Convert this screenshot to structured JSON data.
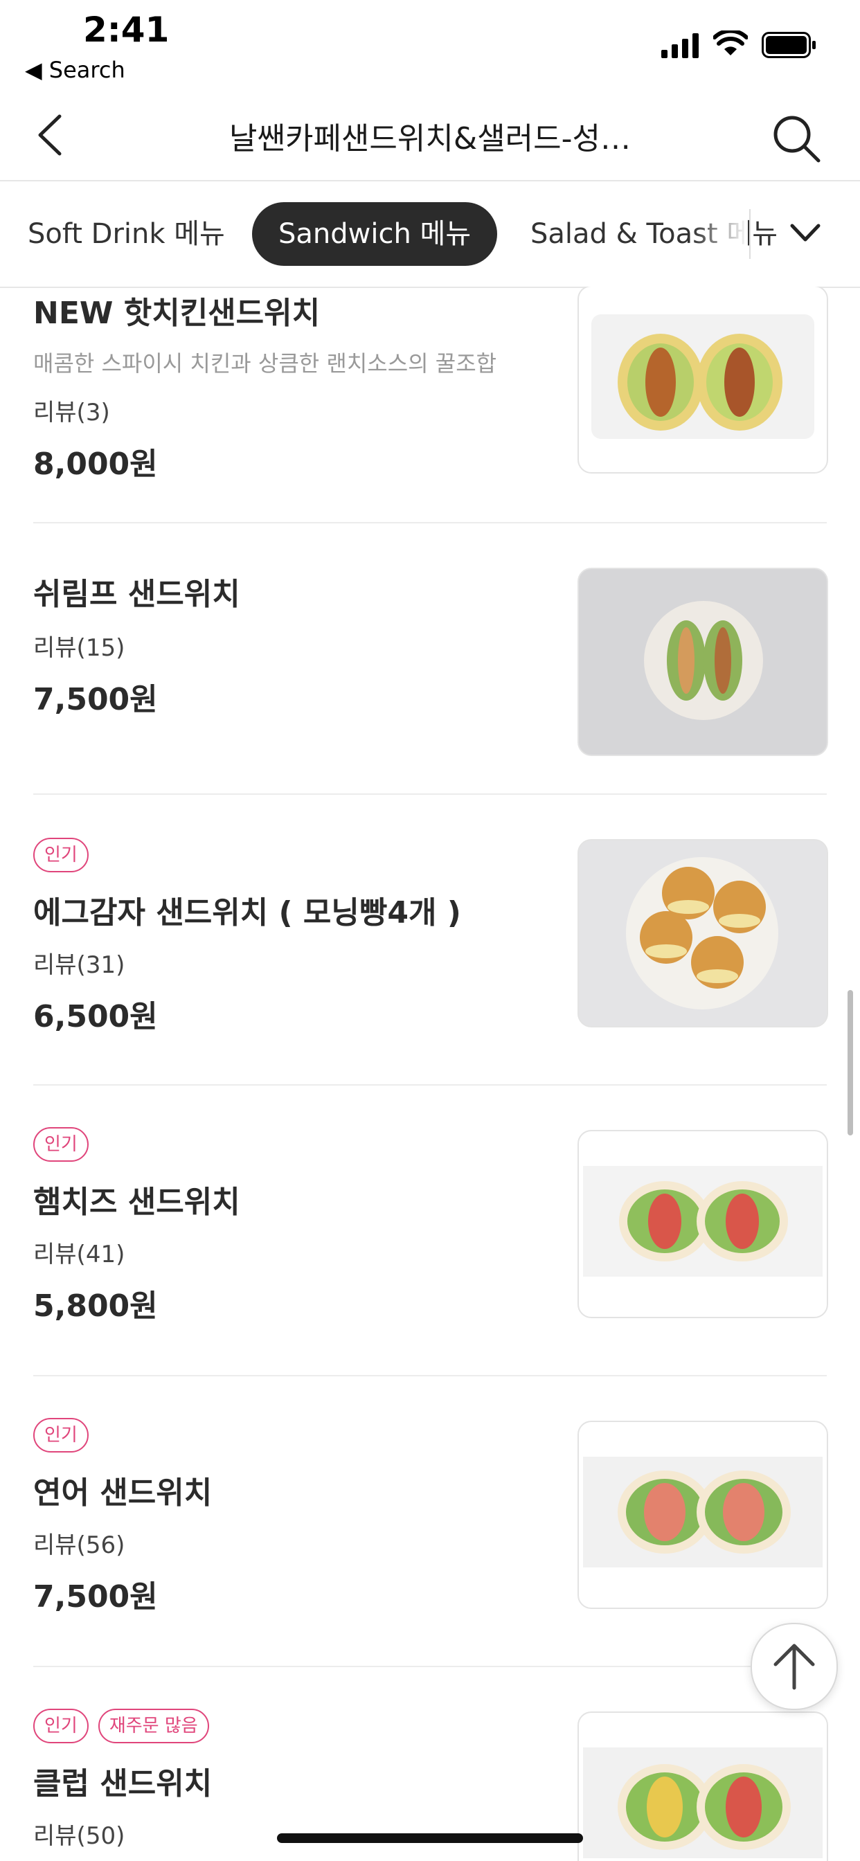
{
  "status_bar": {
    "time": "2:41",
    "back_app": "◀ Search"
  },
  "nav": {
    "title": "날쌘카페샌드위치&샐러드-성…"
  },
  "tabs": [
    {
      "label": "Soft Drink 메뉴",
      "active": false
    },
    {
      "label": "Sandwich 메뉴",
      "active": true
    },
    {
      "label": "Salad & Toast 메뉴",
      "active": false
    }
  ],
  "items": [
    {
      "name": "NEW 핫치킨샌드위치",
      "desc": "매콤한 스파이시 치킨과 상큼한 랜치소스의 꿀조합",
      "review": "리뷰(3)",
      "price": "8,000원",
      "badges": []
    },
    {
      "name": "쉬림프 샌드위치",
      "desc": "",
      "review": "리뷰(15)",
      "price": "7,500원",
      "badges": []
    },
    {
      "name": "에그감자 샌드위치 ( 모닝빵4개 )",
      "desc": "",
      "review": "리뷰(31)",
      "price": "6,500원",
      "badges": [
        "인기"
      ]
    },
    {
      "name": "햄치즈 샌드위치",
      "desc": "",
      "review": "리뷰(41)",
      "price": "5,800원",
      "badges": [
        "인기"
      ]
    },
    {
      "name": "연어 샌드위치",
      "desc": "",
      "review": "리뷰(56)",
      "price": "7,500원",
      "badges": [
        "인기"
      ]
    },
    {
      "name": "클럽 샌드위치",
      "desc": "",
      "review": "리뷰(50)",
      "price": "",
      "badges": [
        "인기",
        "재주문 많음"
      ]
    }
  ],
  "colors": {
    "accent": "#e0457b",
    "active_tab": "#2b2b2b"
  },
  "icons": [
    "back-chevron-icon",
    "search-icon",
    "chevron-down-icon",
    "arrow-up-icon"
  ]
}
